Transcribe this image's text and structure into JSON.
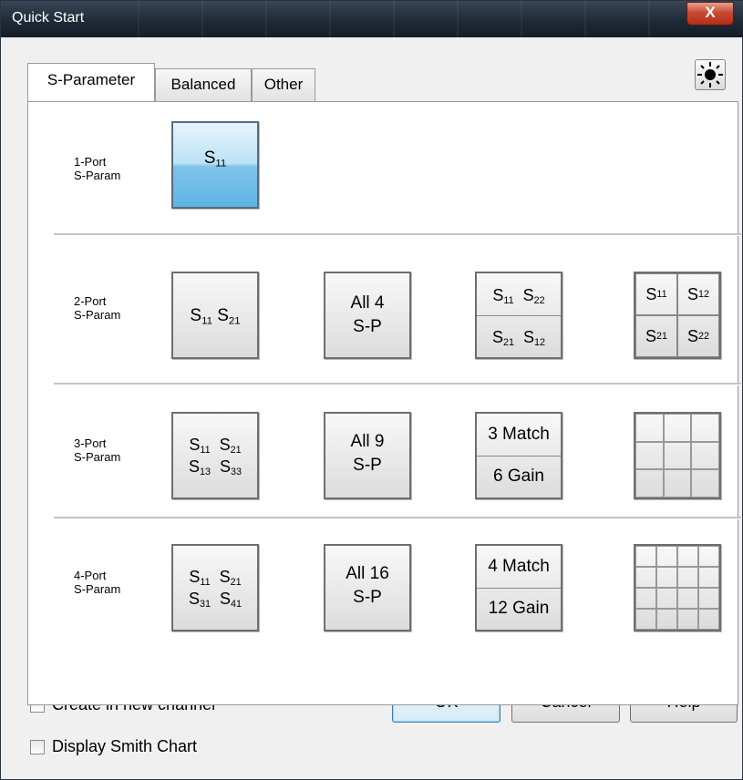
{
  "window": {
    "title": "Quick Start",
    "close_label": "X"
  },
  "tabs": [
    {
      "label": "S-Parameter",
      "active": true
    },
    {
      "label": "Balanced",
      "active": false
    },
    {
      "label": "Other",
      "active": false
    }
  ],
  "toolbar": {
    "brightness_icon": "sun-icon"
  },
  "rows": [
    {
      "label_line1": "1-Port",
      "label_line2": "S-Param"
    },
    {
      "label_line1": "2-Port",
      "label_line2": "S-Param"
    },
    {
      "label_line1": "3-Port",
      "label_line2": "S-Param"
    },
    {
      "label_line1": "4-Port",
      "label_line2": "S-Param"
    }
  ],
  "tiles": {
    "s11": {
      "s": "S",
      "sub": "11"
    },
    "p2_a": {
      "t1": "S",
      "s1": "11",
      "t2": " S",
      "s2": "21"
    },
    "p2_all": {
      "line1": "All 4",
      "line2": "S-P"
    },
    "p2_split": {
      "top_a": "S",
      "top_as": "11",
      "top_b": "S",
      "top_bs": "22",
      "bot_a": "S",
      "bot_as": "21",
      "bot_b": "S",
      "bot_bs": "12"
    },
    "p2_grid": {
      "c1": "S",
      "c1s": "11",
      "c2": "S",
      "c2s": "12",
      "c3": "S",
      "c3s": "21",
      "c4": "S",
      "c4s": "22"
    },
    "p3_a": {
      "r1a": "S",
      "r1as": "11",
      "r1b": "S",
      "r1bs": "21",
      "r2a": "S",
      "r2as": "13",
      "r2b": "S",
      "r2bs": "33"
    },
    "p3_all": {
      "line1": "All 9",
      "line2": "S-P"
    },
    "p3_match": {
      "top": "3 Match",
      "bottom": "6 Gain"
    },
    "p4_a": {
      "r1a": "S",
      "r1as": "11",
      "r1b": "S",
      "r1bs": "21",
      "r2a": "S",
      "r2as": "31",
      "r2b": "S",
      "r2bs": "41"
    },
    "p4_all": {
      "line1": "All 16",
      "line2": "S-P"
    },
    "p4_match": {
      "top": "4 Match",
      "bottom": "12 Gain"
    }
  },
  "options": {
    "create_new_channel": {
      "label": "Create in new channel",
      "checked": false
    },
    "display_smith": {
      "label": "Display Smith Chart",
      "checked": false
    }
  },
  "buttons": {
    "ok": "OK",
    "cancel": "Cancel",
    "help": "Help"
  },
  "colors": {
    "selected_tile": "#5eb4e4",
    "titlebar": "#1f2a37",
    "close": "#c94a32"
  }
}
